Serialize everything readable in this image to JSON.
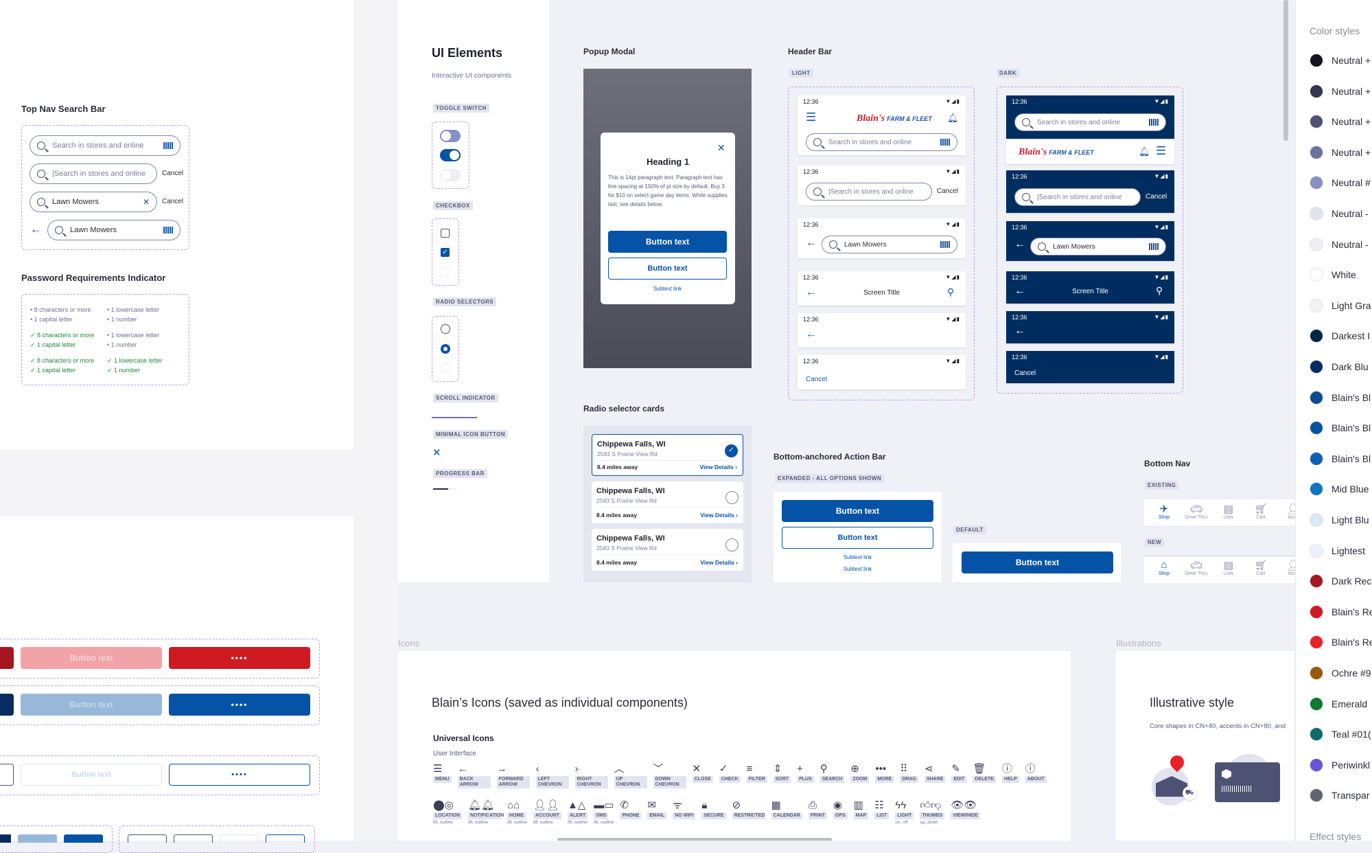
{
  "canvas": {
    "top_nav_search": {
      "title": "Top Nav Search Bar",
      "rows": [
        {
          "type": "placeholder",
          "text": "Search in stores and online",
          "trailing": "barcode"
        },
        {
          "type": "focused",
          "text": "|Search in stores and online",
          "cancel": "Cancel"
        },
        {
          "type": "value",
          "text": "Lawn Mowers",
          "trailing": "clear",
          "cancel": "Cancel"
        },
        {
          "type": "back",
          "text": "Lawn Mowers",
          "trailing": "barcode"
        }
      ]
    },
    "password": {
      "title": "Password Requirements Indicator",
      "groups": [
        [
          {
            "text": "8 characters or more",
            "met": false
          },
          {
            "text": "1 lowercase letter",
            "met": false
          },
          {
            "text": "1 capital letter",
            "met": false
          },
          {
            "text": "1 number",
            "met": false
          }
        ],
        [
          {
            "text": "8 characters or more",
            "met": true
          },
          {
            "text": "1 lowercase letter",
            "met": false
          },
          {
            "text": "1 capital letter",
            "met": true
          },
          {
            "text": "1 number",
            "met": false
          }
        ],
        [
          {
            "text": "8 characters or more",
            "met": true
          },
          {
            "text": "1 lowercase letter",
            "met": true
          },
          {
            "text": "1 capital letter",
            "met": true
          },
          {
            "text": "1 number",
            "met": true
          }
        ]
      ]
    },
    "buttons_partial": {
      "disabled_label": "Button text",
      "loading_label": "••••"
    },
    "ui_elements": {
      "title": "UI Elements",
      "subtitle": "Interactive UI components",
      "toggle_label": "TOGGLE SWITCH",
      "checkbox_label": "CHECKBOX",
      "radio_label": "RADIO SELECTORS",
      "scroll_label": "SCROLL INDICATOR",
      "minimal_icon_label": "MINIMAL ICON BUTTON",
      "progress_label": "PROGRESS BAR",
      "progress_value": 0.6
    },
    "popup_modal": {
      "title": "Popup Modal",
      "heading": "Heading 1",
      "body": "This is 14pt paragraph text. Paragraph text has line spacing at 150% of pt size by default. Buy 3 for $10 on select game day items. While supplies last, see details below.",
      "primary": "Button text",
      "secondary": "Button text",
      "link": "Subtext link",
      "close": "✕"
    },
    "header_bar": {
      "title": "Header Bar",
      "light_label": "LIGHT",
      "dark_label": "DARK",
      "time": "12:36",
      "status_icons": "▼◢▮",
      "logo_script": "Blain's",
      "logo_text": "FARM & FLEET",
      "search_placeholder": "Search in stores and online",
      "search_focused": "|Search in stores and online",
      "search_value": "Lawn Mowers",
      "cancel": "Cancel",
      "screen_title": "Screen Title"
    },
    "radio_cards": {
      "title": "Radio selector cards",
      "cards": [
        {
          "city": "Chippewa Falls, WI",
          "address": "2583 S Prairie View Rd",
          "distance": "8.4 miles away",
          "link": "View Details ›",
          "selected": true
        },
        {
          "city": "Chippewa Falls, WI",
          "address": "2583 S Prairie View Rd",
          "distance": "8.4 miles away",
          "link": "View Details ›",
          "selected": false
        },
        {
          "city": "Chippewa Falls, WI",
          "address": "2583 S Prairie View Rd",
          "distance": "8.4 miles away",
          "link": "View Details ›",
          "selected": false
        }
      ]
    },
    "action_bar": {
      "title": "Bottom-anchored Action Bar",
      "expanded_label": "EXPANDED - ALL OPTIONS SHOWN",
      "default_label": "DEFAULT",
      "primary": "Button text",
      "secondary": "Button text",
      "link1": "Subtext link",
      "link2": "Subtext link"
    },
    "bottom_nav": {
      "title": "Bottom Nav",
      "existing_label": "EXISTING",
      "new_label": "NEW",
      "items": [
        "Shop",
        "Drive Thru",
        "Lists",
        "Cart",
        "Acco"
      ]
    },
    "icons_section": {
      "frame_label": "Icons",
      "title": "Blain’s Icons (saved as individual components)",
      "group": "Universal Icons",
      "subgroup": "User Interface",
      "row1": [
        {
          "glyph": "☰",
          "label": "MENU"
        },
        {
          "glyph": "←",
          "label": "BACK ARROW"
        },
        {
          "glyph": "→",
          "label": "FORWARD ARROW"
        },
        {
          "glyph": "‹",
          "label": "LEFT CHEVRON"
        },
        {
          "glyph": "›",
          "label": "RIGHT CHEVRON"
        },
        {
          "glyph": "︿",
          "label": "UP CHEVRON"
        },
        {
          "glyph": "﹀",
          "label": "DOWN CHEVRON"
        },
        {
          "glyph": "✕",
          "label": "CLOSE"
        },
        {
          "glyph": "✓",
          "label": "CHECK"
        },
        {
          "glyph": "≡",
          "label": "FILTER"
        },
        {
          "glyph": "⇕",
          "label": "SORT"
        },
        {
          "glyph": "+",
          "label": "PLUS"
        },
        {
          "glyph": "⚲",
          "label": "SEARCH"
        },
        {
          "glyph": "⊕",
          "label": "ZOOM"
        },
        {
          "glyph": "•••",
          "label": "MORE"
        },
        {
          "glyph": "⠿",
          "label": "DRAG"
        },
        {
          "glyph": "⋖",
          "label": "SHARE"
        },
        {
          "glyph": "✎",
          "label": "EDIT"
        },
        {
          "glyph": "🗑",
          "label": "DELETE"
        },
        {
          "glyph": "ⓘ",
          "label": "HELP"
        },
        {
          "glyph": "ⓘ",
          "label": "ABOUT"
        }
      ],
      "row2": [
        {
          "glyph": "⬤◎",
          "label": "LOCATION",
          "sub": "fill, outline"
        },
        {
          "glyph": "🔔︎🔔︎",
          "label": "NOTIFICATION",
          "sub": "fill, outline"
        },
        {
          "glyph": "⌂⌂",
          "label": "HOME",
          "sub": "fill, outline"
        },
        {
          "glyph": "👤︎👤︎",
          "label": "ACCOUNT",
          "sub": "fill, outline"
        },
        {
          "glyph": "▲△",
          "label": "ALERT",
          "sub": "fill, outline"
        },
        {
          "glyph": "▬▭",
          "label": "SMS",
          "sub": "fill, outline"
        },
        {
          "glyph": "✆",
          "label": "PHONE"
        },
        {
          "glyph": "✉",
          "label": "EMAIL"
        },
        {
          "glyph": "ᯤ",
          "label": "NO WIFI"
        },
        {
          "glyph": "🔒︎",
          "label": "SECURE"
        },
        {
          "glyph": "⊘",
          "label": "RESTRICTED"
        },
        {
          "glyph": "▦",
          "label": "CALENDAR"
        },
        {
          "glyph": "⎙",
          "label": "PRINT"
        },
        {
          "glyph": "◉",
          "label": "GPS"
        },
        {
          "glyph": "▥",
          "label": "MAP"
        },
        {
          "glyph": "☷",
          "label": "LIST"
        },
        {
          "glyph": "ϟϟ",
          "label": "LIGHT",
          "sub": "on, off"
        },
        {
          "glyph": "👍︎👎︎",
          "label": "THUMBS",
          "sub": "up, down"
        },
        {
          "glyph": "👁︎👁︎",
          "label": "VIEW/HIDE"
        }
      ]
    },
    "illustrations": {
      "frame_label": "Illustrations",
      "title": "Illustrative style",
      "subtitle": "Core shapes in CN+40, accents in CN+80, and"
    }
  },
  "color_styles": {
    "title": "Color styles",
    "effects_title": "Effect styles",
    "items": [
      {
        "name": "Neutral +",
        "color": "#13141f"
      },
      {
        "name": "Neutral +",
        "color": "#33364d"
      },
      {
        "name": "Neutral +",
        "color": "#4d5275"
      },
      {
        "name": "Neutral +",
        "color": "#6b729c"
      },
      {
        "name": "Neutral #",
        "color": "#8790c4"
      },
      {
        "name": "Neutral -",
        "color": "#e1e3ef"
      },
      {
        "name": "Neutral -",
        "color": "#eeeff5"
      },
      {
        "name": "White",
        "color": "#ffffff"
      },
      {
        "name": "Light Gra",
        "color": "#f2f2f2"
      },
      {
        "name": "Darkest I",
        "color": "#032744"
      },
      {
        "name": "Dark Blu",
        "color": "#062d63"
      },
      {
        "name": "Blain's Bl",
        "color": "#0b4c94"
      },
      {
        "name": "Blain's Bl",
        "color": "#0553a6"
      },
      {
        "name": "Blain's Bl",
        "color": "#0d60b5"
      },
      {
        "name": "Mid Blue",
        "color": "#1075bd"
      },
      {
        "name": "Light Blu",
        "color": "#d8eaf8"
      },
      {
        "name": "Lightest",
        "color": "#e9f2fb"
      },
      {
        "name": "Dark Rec",
        "color": "#a8161f"
      },
      {
        "name": "Blain's Re",
        "color": "#cf1a22"
      },
      {
        "name": "Blain's Re",
        "color": "#e82027"
      },
      {
        "name": "Ochre #9",
        "color": "#9a5a05"
      },
      {
        "name": "Emerald",
        "color": "#0c7a2f"
      },
      {
        "name": "Teal #01(",
        "color": "#0d6c6b"
      },
      {
        "name": "Periwinkl",
        "color": "#6a55d6"
      },
      {
        "name": "Transpar",
        "color": "#626370"
      }
    ]
  }
}
